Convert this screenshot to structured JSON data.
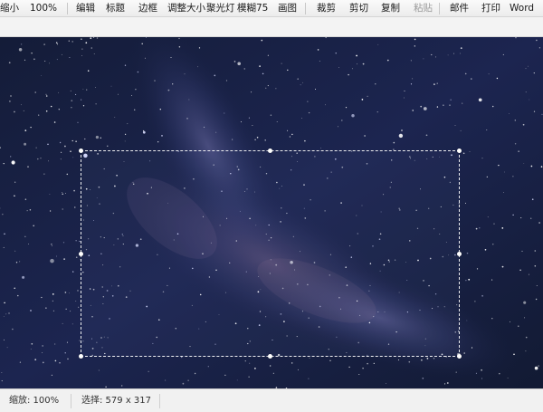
{
  "toolbar": {
    "zoom_out": "缩小",
    "zoom_level": "100%",
    "edit": "编辑",
    "title": "标题",
    "border": "边框",
    "resize": "调整大小",
    "spotlight": "聚光灯",
    "blur": "模糊75",
    "draw": "画图",
    "crop": "裁剪",
    "cut": "剪切",
    "copy": "复制",
    "paste": "粘贴",
    "mail": "邮件",
    "print": "打印",
    "word": "Word"
  },
  "status": {
    "zoom": "缩放: 100%",
    "selection": "选择: 579 x 317"
  },
  "image": {
    "subject": "starry night sky with milky way",
    "background_color": "#121a33",
    "accent_color": "#5a5f9a"
  },
  "selection": {
    "border_color": "#ffffff"
  }
}
